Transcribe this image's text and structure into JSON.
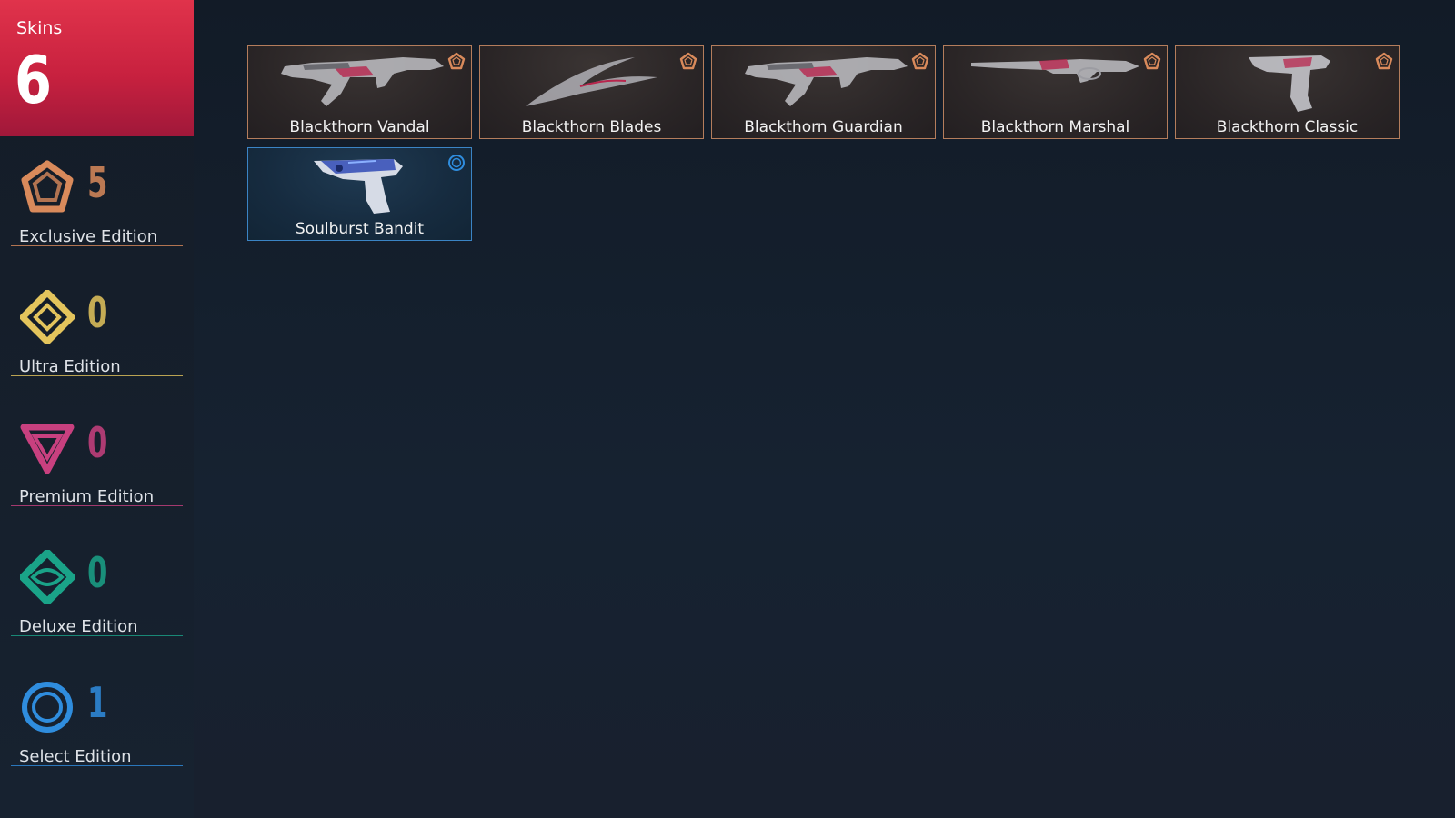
{
  "summary": {
    "label": "Skins",
    "count": "6",
    "accent": "#d72a45"
  },
  "tiers": [
    {
      "id": "exclusive",
      "label": "Exclusive Edition",
      "count": "5",
      "color": "#d98a5b",
      "icon": "exclusive-edition-icon"
    },
    {
      "id": "ultra",
      "label": "Ultra Edition",
      "count": "0",
      "color": "#e3c45c",
      "icon": "ultra-edition-icon"
    },
    {
      "id": "premium",
      "label": "Premium Edition",
      "count": "0",
      "color": "#c8407f",
      "icon": "premium-edition-icon"
    },
    {
      "id": "deluxe",
      "label": "Deluxe Edition",
      "count": "0",
      "color": "#1aa388",
      "icon": "deluxe-edition-icon"
    },
    {
      "id": "select",
      "label": "Select Edition",
      "count": "1",
      "color": "#2f8dde",
      "icon": "select-edition-icon"
    }
  ],
  "skins": [
    {
      "name": "Blackthorn Vandal",
      "tier": "exclusive",
      "weapon": "rifle-icon"
    },
    {
      "name": "Blackthorn Blades",
      "tier": "exclusive",
      "weapon": "blade-icon"
    },
    {
      "name": "Blackthorn Guardian",
      "tier": "exclusive",
      "weapon": "rifle-icon"
    },
    {
      "name": "Blackthorn Marshal",
      "tier": "exclusive",
      "weapon": "sniper-icon"
    },
    {
      "name": "Blackthorn Classic",
      "tier": "exclusive",
      "weapon": "pistol-icon"
    },
    {
      "name": "Soulburst Bandit",
      "tier": "select",
      "weapon": "pistol-icon"
    }
  ]
}
